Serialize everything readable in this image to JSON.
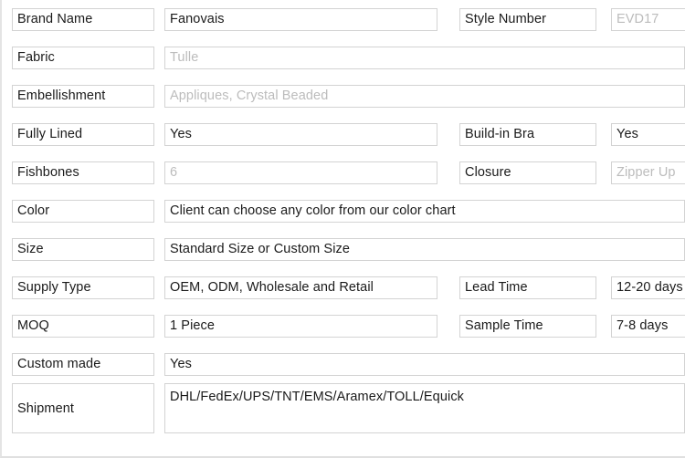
{
  "table": {
    "rows": [
      {
        "label": "Brand Name",
        "value": "Fanovais",
        "value_muted": false,
        "label2": "Style Number",
        "value2": "EVD17",
        "value2_muted": true,
        "wide": false
      },
      {
        "label": "Fabric",
        "value": "Tulle",
        "value_muted": true,
        "wide": true
      },
      {
        "label": "Embellishment",
        "value": "Appliques, Crystal Beaded",
        "value_muted": true,
        "wide": true
      },
      {
        "label": "Fully Lined",
        "value": "Yes",
        "value_muted": false,
        "label2": "Build-in Bra",
        "value2": "Yes",
        "value2_muted": false,
        "wide": false
      },
      {
        "label": "Fishbones",
        "value": "6",
        "value_muted": true,
        "label2": "Closure",
        "value2": "Zipper Up",
        "value2_muted": true,
        "wide": false
      },
      {
        "label": "Color",
        "value": "Client can choose any color from our color chart",
        "value_muted": false,
        "wide": true
      },
      {
        "label": "Size",
        "value": "Standard Size or Custom Size",
        "value_muted": false,
        "wide": true
      },
      {
        "label": "Supply Type",
        "value": "OEM,  ODM, Wholesale and Retail",
        "value_muted": false,
        "label2": "Lead Time",
        "value2": "12-20 days",
        "value2_muted": false,
        "wide": false
      },
      {
        "label": "MOQ",
        "value": "1 Piece",
        "value_muted": false,
        "label2": "Sample  Time",
        "value2": "7-8 days",
        "value2_muted": false,
        "wide": false
      },
      {
        "label": "Custom made",
        "value": "Yes",
        "value_muted": false,
        "wide": true
      },
      {
        "label": "Shipment",
        "value": "DHL/FedEx/UPS/TNT/EMS/Aramex/TOLL/Equick",
        "value_muted": false,
        "wide": true,
        "tall": true
      }
    ]
  },
  "colors": {
    "cell_border": "#d3d3d3",
    "text": "#1a1a1a",
    "text_muted": "#bcbcbc",
    "outer_border": "#e2e2e2",
    "background": "#ffffff"
  }
}
